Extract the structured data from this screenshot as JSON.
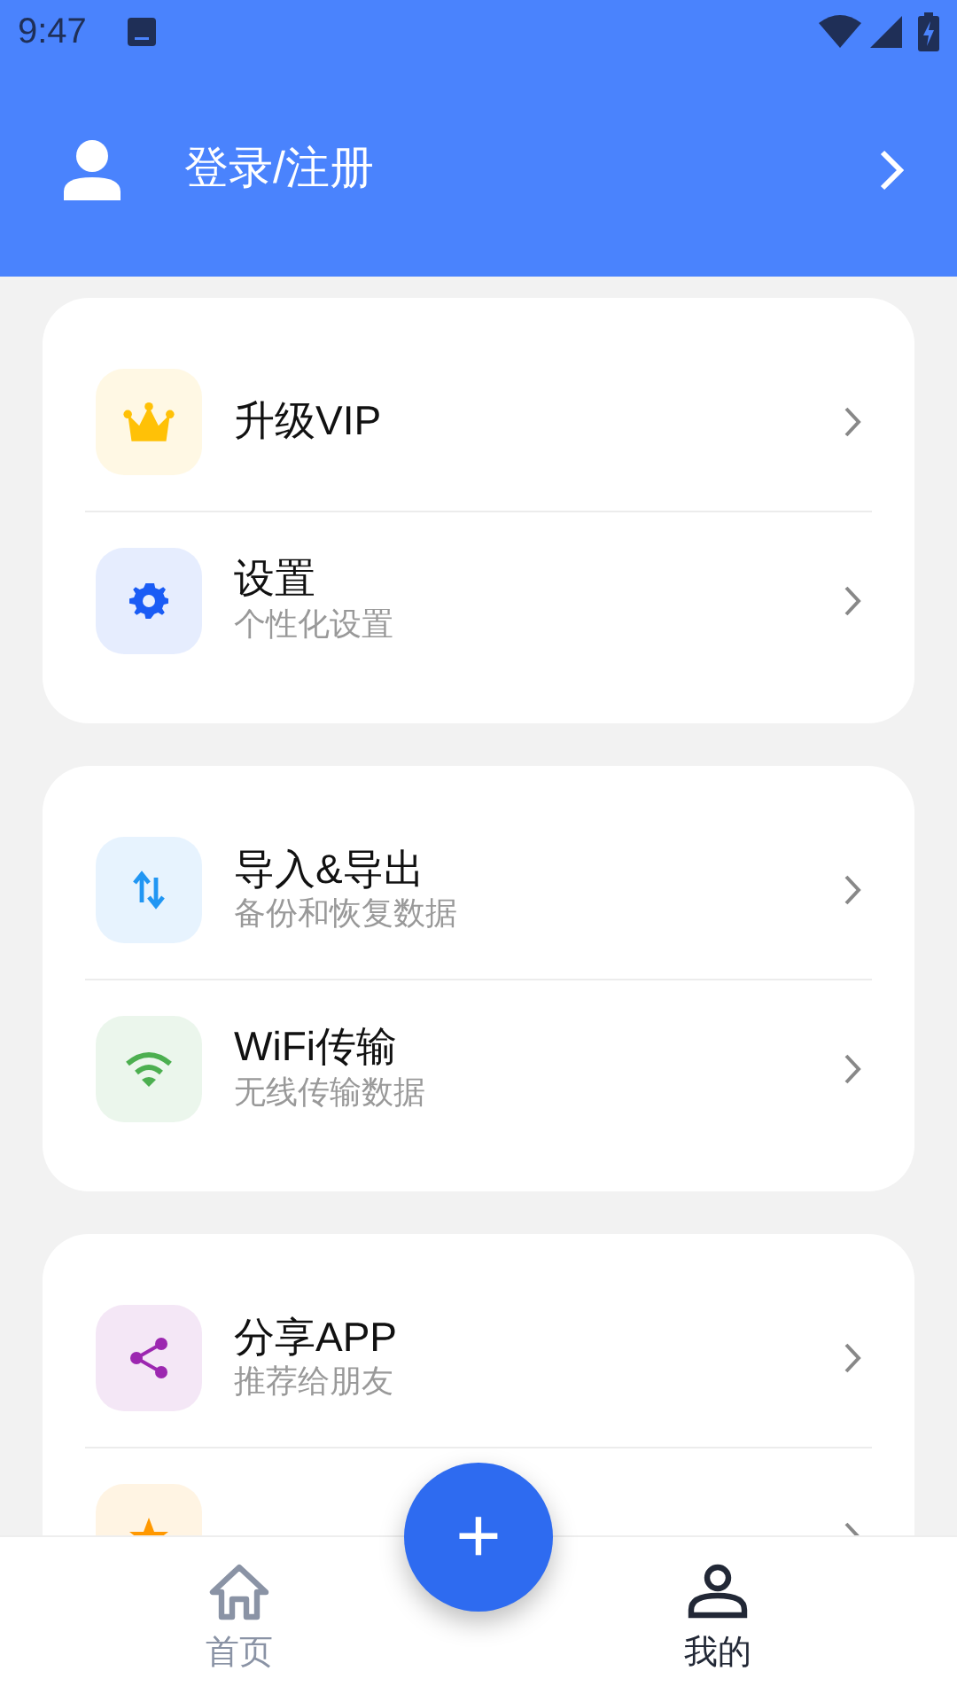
{
  "status_bar": {
    "time": "9:47"
  },
  "header": {
    "label": "登录/注册"
  },
  "sections": [
    {
      "items": [
        {
          "title": "升级VIP",
          "color": "#ffc107"
        },
        {
          "title": "设置",
          "subtitle": "个性化设置",
          "color": "#1a5cf5"
        }
      ]
    },
    {
      "items": [
        {
          "title": "导入&导出",
          "subtitle": "备份和恢复数据",
          "color": "#2196f3"
        },
        {
          "title": "WiFi传输",
          "subtitle": "无线传输数据",
          "color": "#4caf50"
        }
      ]
    },
    {
      "items": [
        {
          "title": "分享APP",
          "subtitle": "推荐给朋友",
          "color": "#9c27b0"
        },
        {
          "color": "#ff9800"
        }
      ]
    }
  ],
  "fab": {
    "label": "+"
  },
  "tabs": [
    {
      "label": "首页",
      "selected": false
    },
    {
      "label": "我的",
      "selected": true
    }
  ]
}
